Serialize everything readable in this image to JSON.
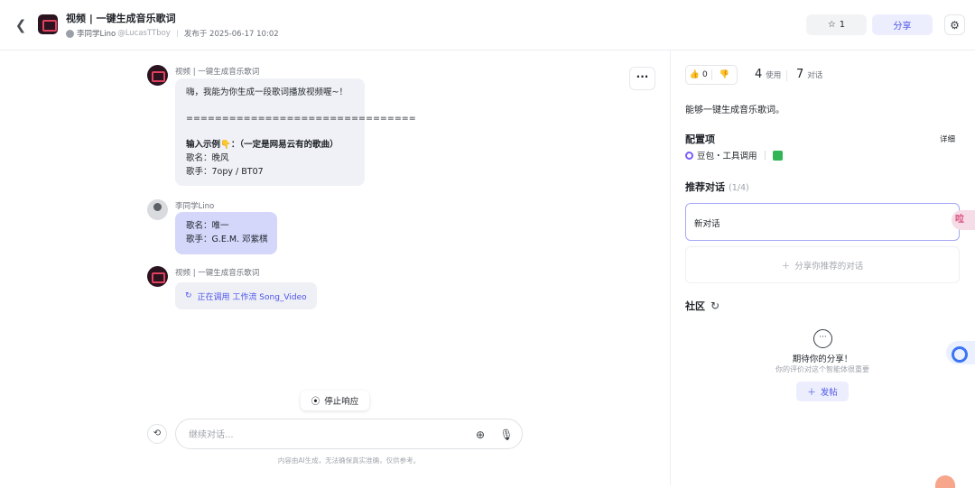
{
  "header": {
    "back_icon": "chevron-left-icon",
    "bot_title": "视频 | 一键生成音乐歌词",
    "author_name": "李同学Lino",
    "author_handle": "@LucasTTboy",
    "publish_text": "发布于 2025-06-17 10:02",
    "star_count": "1",
    "share_label": "分享"
  },
  "chat": {
    "more_label": "···",
    "messages": [
      {
        "name": "视频 | 一键生成音乐歌词",
        "line1": "嗨，我能为你生成一段歌词播放视频喔~！",
        "line2": "================================",
        "line3": "输入示例👇：（一定是网易云有的歌曲）",
        "line4": "歌名：晚风",
        "line5": "歌手：7opy / BT07"
      },
      {
        "name": "李同学Lino",
        "line1": "歌名：唯一",
        "line2": "歌手：G.E.M. 邓紫棋"
      },
      {
        "name": "视频 | 一键生成音乐歌词",
        "workflow_text": "正在调用 工作流 Song_Video"
      }
    ],
    "stop_label": "停止响应",
    "input_placeholder": "继续对话...",
    "disclaimer": "内容由AI生成，无法确保真实准确，仅供参考。"
  },
  "panel": {
    "likes": "0",
    "uses_count": "4",
    "uses_label": "使用",
    "conv_count": "7",
    "conv_label": "对话",
    "description": "能够一键生成音乐歌词。",
    "config_title": "配置项",
    "detail_label": "详细",
    "model_label": "豆包・工具调用",
    "rec_title": "推荐对话",
    "rec_count": "(1/4)",
    "new_conv": "新对话",
    "share_rec": "分享你推荐的对话",
    "community_title": "社区",
    "empty_title": "期待你的分享！",
    "empty_sub": "你的评价对这个智能体很重要",
    "post_label": "发帖"
  },
  "floating": {
    "pink_text": "㕸"
  }
}
